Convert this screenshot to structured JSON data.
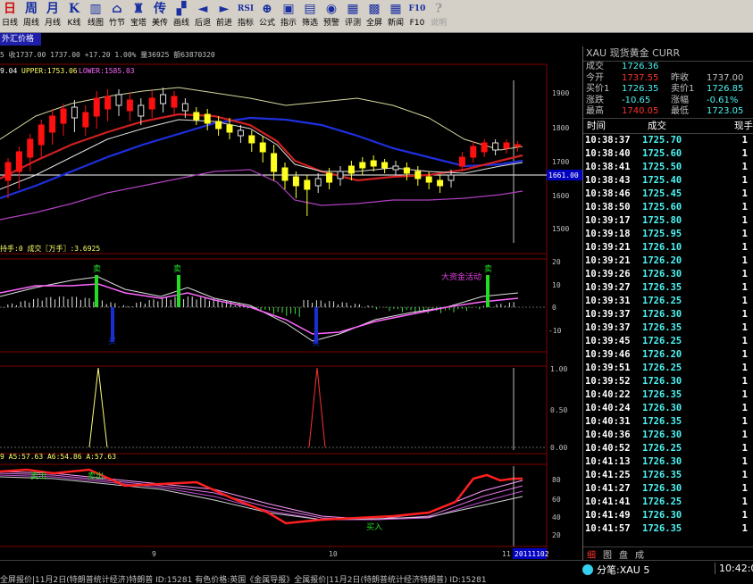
{
  "toolbar": [
    {
      "icon": "日",
      "label": "日线"
    },
    {
      "icon": "周",
      "label": "周线"
    },
    {
      "icon": "月",
      "label": "月线"
    },
    {
      "icon": "K",
      "label": "K线"
    },
    {
      "icon": "▥",
      "label": "线图"
    },
    {
      "icon": "⌂",
      "label": "竹节"
    },
    {
      "icon": "♜",
      "label": "宝塔"
    },
    {
      "icon": "传",
      "label": "美传"
    },
    {
      "icon": "▞",
      "label": "画线"
    },
    {
      "icon": "◄",
      "label": "后退"
    },
    {
      "icon": "►",
      "label": "前进"
    },
    {
      "icon": "RSI",
      "label": "指标"
    },
    {
      "icon": "⊕",
      "label": "公式"
    },
    {
      "icon": "▣",
      "label": "指示"
    },
    {
      "icon": "▤",
      "label": "筛选"
    },
    {
      "icon": "◉",
      "label": "预警"
    },
    {
      "icon": "▦",
      "label": "评测"
    },
    {
      "icon": "▩",
      "label": "全屏"
    },
    {
      "icon": "▦",
      "label": "新闻"
    },
    {
      "icon": "F10",
      "label": "F10"
    },
    {
      "icon": "?",
      "label": "说明"
    }
  ],
  "price_tab": "外汇价格",
  "main_chart": {
    "info_line": "5 收1737.00 1737.00 +17.20 1.00% 量36925 额63870320",
    "boll_mid": "9.04",
    "boll_upper": "UPPER:1753.06",
    "boll_lower": "LOWER:1585.03",
    "y_ticks": [
      "1900",
      "1800",
      "1700",
      "1600",
      "1500"
    ],
    "current_price": "1661.00"
  },
  "panel2": {
    "info": "持手:0 成交〖万手〗:3.6925",
    "y_ticks": [
      "20",
      "10",
      "0",
      "-10"
    ],
    "annotation": "大资金活动",
    "sell1": "卖",
    "sell2": "卖",
    "sell3": "卖",
    "buy1": "买",
    "buy2": "买"
  },
  "panel3": {
    "y_ticks": [
      "1.00",
      "0.50",
      "0.00"
    ]
  },
  "panel4": {
    "info": "9 A5:57.63 A6:54.86 A:57.63",
    "y_ticks": [
      "80",
      "60",
      "40",
      "20"
    ],
    "sell_a": "卖出",
    "sell_b": "卖出",
    "buy": "买入"
  },
  "x_axis": {
    "labels": [
      "9",
      "10",
      "11"
    ],
    "date_box": "20111102"
  },
  "quote": {
    "header": "XAU 现货黄金  CURR",
    "rows": [
      [
        {
          "l": "成交",
          "v": "1726.36",
          "c": "#4ef2f2"
        }
      ],
      [
        {
          "l": "今开",
          "v": "1737.55",
          "c": "#ff3030"
        },
        {
          "l": "昨收",
          "v": "1737.00",
          "c": "#c0c0c0"
        }
      ],
      [
        {
          "l": "买价1",
          "v": "1726.35",
          "c": "#4ef2f2"
        },
        {
          "l": "卖价1",
          "v": "1726.85",
          "c": "#4ef2f2"
        }
      ],
      [
        {
          "l": "涨跌",
          "v": "-10.65",
          "c": "#4ef2f2"
        },
        {
          "l": "涨幅",
          "v": "-0.61%",
          "c": "#4ef2f2"
        }
      ],
      [
        {
          "l": "最高",
          "v": "1740.05",
          "c": "#ff3030"
        },
        {
          "l": "最低",
          "v": "1723.05",
          "c": "#4ef2f2"
        }
      ]
    ],
    "ticks_header": {
      "time": "时间",
      "price": "成交",
      "vol": "现手"
    },
    "ticks": [
      [
        "10:38:37",
        "1725.70",
        "1"
      ],
      [
        "10:38:40",
        "1725.60",
        "1"
      ],
      [
        "10:38:41",
        "1725.50",
        "1"
      ],
      [
        "10:38:43",
        "1725.40",
        "1"
      ],
      [
        "10:38:46",
        "1725.45",
        "1"
      ],
      [
        "10:38:50",
        "1725.60",
        "1"
      ],
      [
        "10:39:17",
        "1725.80",
        "1"
      ],
      [
        "10:39:18",
        "1725.95",
        "1"
      ],
      [
        "10:39:21",
        "1726.10",
        "1"
      ],
      [
        "10:39:21",
        "1726.20",
        "1"
      ],
      [
        "10:39:26",
        "1726.30",
        "1"
      ],
      [
        "10:39:27",
        "1726.35",
        "1"
      ],
      [
        "10:39:31",
        "1726.25",
        "1"
      ],
      [
        "10:39:37",
        "1726.30",
        "1"
      ],
      [
        "10:39:37",
        "1726.35",
        "1"
      ],
      [
        "10:39:45",
        "1726.25",
        "1"
      ],
      [
        "10:39:46",
        "1726.20",
        "1"
      ],
      [
        "10:39:51",
        "1726.25",
        "1"
      ],
      [
        "10:39:52",
        "1726.30",
        "1"
      ],
      [
        "10:40:22",
        "1726.35",
        "1"
      ],
      [
        "10:40:24",
        "1726.30",
        "1"
      ],
      [
        "10:40:31",
        "1726.35",
        "1"
      ],
      [
        "10:40:36",
        "1726.30",
        "1"
      ],
      [
        "10:40:52",
        "1726.25",
        "1"
      ],
      [
        "10:41:13",
        "1726.30",
        "1"
      ],
      [
        "10:41:25",
        "1726.35",
        "1"
      ],
      [
        "10:41:27",
        "1726.30",
        "1"
      ],
      [
        "10:41:41",
        "1726.25",
        "1"
      ],
      [
        "10:41:49",
        "1726.30",
        "1"
      ],
      [
        "10:41:57",
        "1726.35",
        "1"
      ]
    ],
    "tabs": [
      "细",
      "图",
      "盘",
      "成"
    ]
  },
  "bottom": {
    "left_text": "全屏报价|11月2日(特朗普统计经济)特朗普 ID:15281     有色价格:英国《金属导报》全属报价|11月2日(特朗普统计经济特朗普) ID:15281",
    "fenbi": "分笔:XAU 5",
    "time": "10:42:0"
  }
}
